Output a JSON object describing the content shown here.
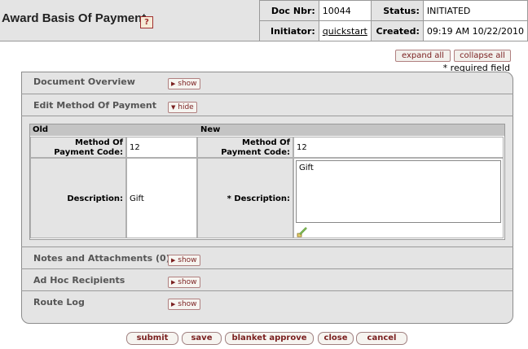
{
  "header": {
    "title": "Award Basis Of Payment",
    "help_icon": "help-icon",
    "doc_nbr_label": "Doc Nbr:",
    "doc_nbr": "10044",
    "status_label": "Status:",
    "status": "INITIATED",
    "initiator_label": "Initiator:",
    "initiator": "quickstart",
    "created_label": "Created:",
    "created": "09:19 AM 10/22/2010"
  },
  "controls": {
    "expand_all": "expand all",
    "collapse_all": "collapse all",
    "required_note": "* required field"
  },
  "tabs": {
    "document_overview": {
      "label": "Document Overview",
      "button": "show"
    },
    "edit_method": {
      "label": "Edit Method Of Payment",
      "button": "hide"
    },
    "notes": {
      "label": "Notes and Attachments (0)",
      "button": "show"
    },
    "adhoc": {
      "label": "Ad Hoc Recipients",
      "button": "show"
    },
    "route_log": {
      "label": "Route Log",
      "button": "show"
    }
  },
  "edit": {
    "old_header": "Old",
    "new_header": "New",
    "code_label_line1": "Method Of",
    "code_label_line2": "Payment Code:",
    "old_code": "12",
    "new_code": "12",
    "desc_label": "Description:",
    "new_desc_label": "* Description:",
    "old_desc": "Gift",
    "new_desc": "Gift"
  },
  "buttons": {
    "submit": "submit",
    "save": "save",
    "blanket_approve": "blanket approve",
    "close": "close",
    "cancel": "cancel"
  }
}
